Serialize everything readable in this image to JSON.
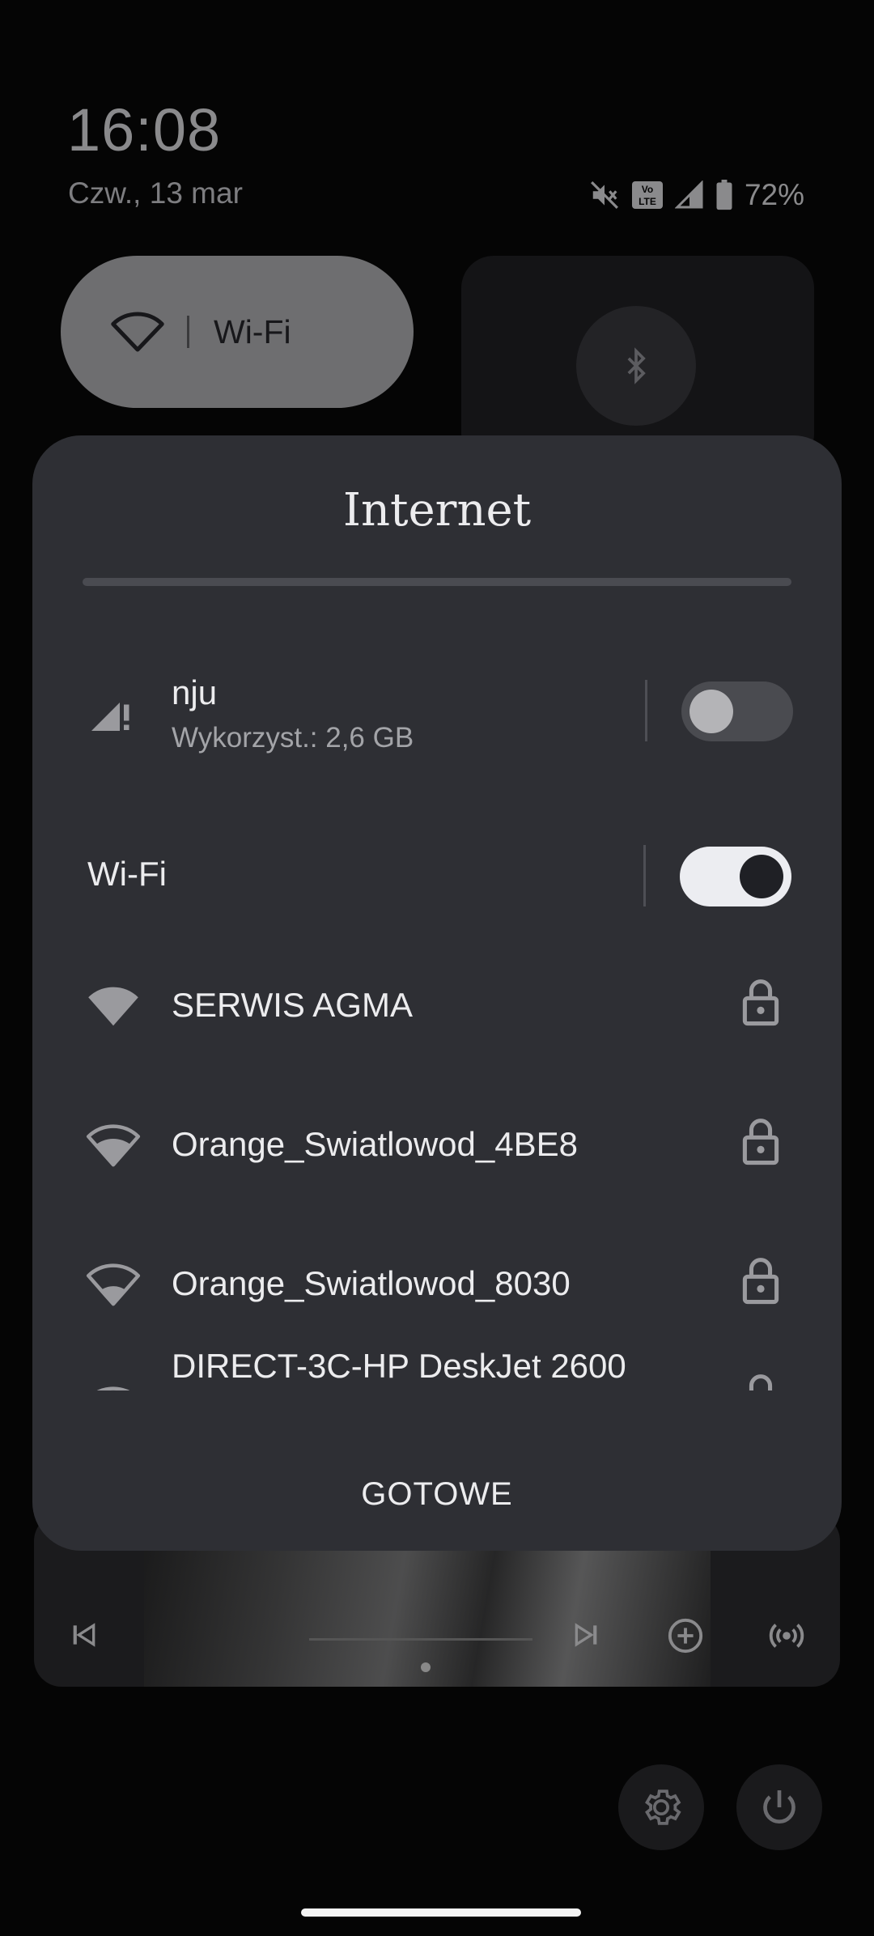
{
  "status": {
    "time": "16:08",
    "date": "Czw., 13 mar",
    "battery": "72%",
    "icons": [
      "mute-icon",
      "volte-icon",
      "signal-icon",
      "battery-icon"
    ]
  },
  "tiles": {
    "wifi_label": "Wi-Fi"
  },
  "dialog": {
    "title": "Internet",
    "mobile": {
      "name": "nju",
      "usage": "Wykorzyst.: 2,6 GB",
      "enabled": false
    },
    "wifi": {
      "label": "Wi-Fi",
      "enabled": true
    },
    "networks": [
      {
        "name": "SERWIS AGMA",
        "signal_level": 4,
        "secured": true
      },
      {
        "name": "Orange_Swiatlowod_4BE8",
        "signal_level": 3,
        "secured": true
      },
      {
        "name": "Orange_Swiatlowod_8030",
        "signal_level": 2,
        "secured": true
      },
      {
        "name": "DIRECT-3C-HP DeskJet 2600",
        "signal_level": 1,
        "secured": true
      }
    ],
    "done_label": "GOTOWE"
  },
  "colors": {
    "dialog_bg": "#2e2f34",
    "toggle_on_track": "#ecedf1",
    "toggle_off_track": "#4a4b50"
  }
}
